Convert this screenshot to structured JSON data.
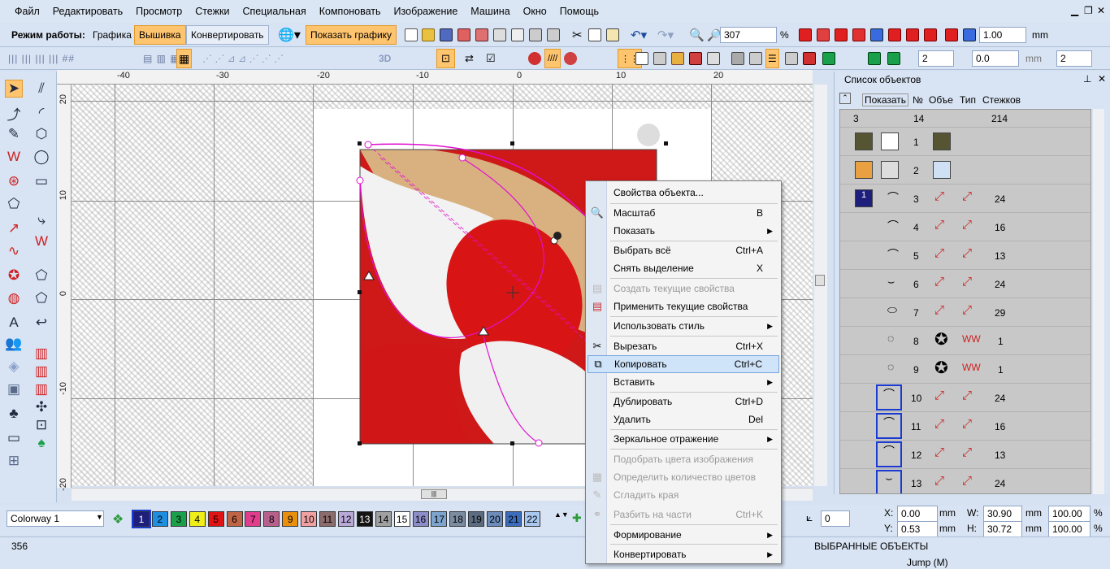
{
  "menubar": {
    "items": [
      "Файл",
      "Редактировать",
      "Просмотр",
      "Стежки",
      "Специальная",
      "Компоновать",
      "Изображение",
      "Машина",
      "Окно",
      "Помощь"
    ]
  },
  "toolbar": {
    "mode_label": "Режим работы:",
    "modes": [
      "Графика",
      "Вышивка",
      "Конвертировать"
    ],
    "show_graphics": "Показать графику",
    "zoom_value": "307",
    "zoom_unit": "%",
    "stitch_value": "1.00",
    "stitch_unit": "mm",
    "spin1": "2",
    "spin2": "0.0",
    "spin2_unit": "mm",
    "spin3": "2",
    "label_3d": "3D"
  },
  "ruler": {
    "top": [
      "-40",
      "-30",
      "-20",
      "-10",
      "0",
      "10",
      "20"
    ],
    "left": [
      "20",
      "10",
      "0",
      "-10",
      "-20"
    ]
  },
  "object_panel": {
    "title": "Список объектов",
    "headers": {
      "show": "Показать",
      "num": "№",
      "obj": "Объект",
      "type": "Тип",
      "stitches": "Стежков"
    },
    "summary": {
      "show": "3",
      "num": "14",
      "stitches": "214"
    },
    "rows": [
      {
        "num": "1",
        "stitches": ""
      },
      {
        "num": "2",
        "stitches": ""
      },
      {
        "num": "3",
        "stitches": "24"
      },
      {
        "num": "4",
        "stitches": "16"
      },
      {
        "num": "5",
        "stitches": "13"
      },
      {
        "num": "6",
        "stitches": "24"
      },
      {
        "num": "7",
        "stitches": "29"
      },
      {
        "num": "8",
        "stitches": "1"
      },
      {
        "num": "9",
        "stitches": "1"
      },
      {
        "num": "10",
        "stitches": "24"
      },
      {
        "num": "11",
        "stitches": "16"
      },
      {
        "num": "12",
        "stitches": "13"
      },
      {
        "num": "13",
        "stitches": "24"
      }
    ],
    "group_label": "1"
  },
  "context_menu": {
    "items": [
      {
        "label": "Свойства объекта...",
        "shortcut": "",
        "arrow": false,
        "disabled": false
      },
      {
        "label": "Масштаб",
        "shortcut": "B",
        "arrow": false,
        "disabled": false
      },
      {
        "label": "Показать",
        "shortcut": "",
        "arrow": true,
        "disabled": false
      },
      {
        "label": "Выбрать всё",
        "shortcut": "Ctrl+A",
        "arrow": false,
        "disabled": false
      },
      {
        "label": "Снять выделение",
        "shortcut": "X",
        "arrow": false,
        "disabled": false
      },
      {
        "label": "Создать текущие свойства",
        "shortcut": "",
        "arrow": false,
        "disabled": true
      },
      {
        "label": "Применить текущие свойства",
        "shortcut": "",
        "arrow": false,
        "disabled": false
      },
      {
        "label": "Использовать стиль",
        "shortcut": "",
        "arrow": true,
        "disabled": false
      },
      {
        "label": "Вырезать",
        "shortcut": "Ctrl+X",
        "arrow": false,
        "disabled": false
      },
      {
        "label": "Копировать",
        "shortcut": "Ctrl+C",
        "arrow": false,
        "disabled": false
      },
      {
        "label": "Вставить",
        "shortcut": "",
        "arrow": true,
        "disabled": false
      },
      {
        "label": "Дублировать",
        "shortcut": "Ctrl+D",
        "arrow": false,
        "disabled": false
      },
      {
        "label": "Удалить",
        "shortcut": "Del",
        "arrow": false,
        "disabled": false
      },
      {
        "label": "Зеркальное отражение",
        "shortcut": "",
        "arrow": true,
        "disabled": false
      },
      {
        "label": "Подобрать цвета изображения",
        "shortcut": "",
        "arrow": false,
        "disabled": true
      },
      {
        "label": "Определить количество цветов",
        "shortcut": "",
        "arrow": false,
        "disabled": true
      },
      {
        "label": "Сгладить края",
        "shortcut": "",
        "arrow": false,
        "disabled": true
      },
      {
        "label": "Разбить на части",
        "shortcut": "Ctrl+K",
        "arrow": false,
        "disabled": true
      },
      {
        "label": "Формирование",
        "shortcut": "",
        "arrow": true,
        "disabled": false
      },
      {
        "label": "Конвертировать",
        "shortcut": "",
        "arrow": true,
        "disabled": false
      }
    ]
  },
  "palette": {
    "colorway": "Colorway 1",
    "swatches": [
      {
        "n": "1",
        "c": "#1e1e7c",
        "t": "#fff"
      },
      {
        "n": "2",
        "c": "#1e8ee0",
        "t": "#000"
      },
      {
        "n": "3",
        "c": "#1aa04a",
        "t": "#000"
      },
      {
        "n": "4",
        "c": "#f0ee18",
        "t": "#000"
      },
      {
        "n": "5",
        "c": "#e01414",
        "t": "#000"
      },
      {
        "n": "6",
        "c": "#c06446",
        "t": "#000"
      },
      {
        "n": "7",
        "c": "#e23c8c",
        "t": "#000"
      },
      {
        "n": "8",
        "c": "#b8608c",
        "t": "#000"
      },
      {
        "n": "9",
        "c": "#e8900c",
        "t": "#000"
      },
      {
        "n": "10",
        "c": "#f0a0a0",
        "t": "#000"
      },
      {
        "n": "11",
        "c": "#8c6c6c",
        "t": "#000"
      },
      {
        "n": "12",
        "c": "#b8a8d8",
        "t": "#000"
      },
      {
        "n": "13",
        "c": "#141414",
        "t": "#fff"
      },
      {
        "n": "14",
        "c": "#a0a0a0",
        "t": "#000"
      },
      {
        "n": "15",
        "c": "#ffffff",
        "t": "#000"
      },
      {
        "n": "16",
        "c": "#8c8cc8",
        "t": "#000"
      },
      {
        "n": "17",
        "c": "#7ca4cc",
        "t": "#000"
      },
      {
        "n": "18",
        "c": "#7c8ca0",
        "t": "#000"
      },
      {
        "n": "19",
        "c": "#5c6c80",
        "t": "#000"
      },
      {
        "n": "20",
        "c": "#6c8cbc",
        "t": "#000"
      },
      {
        "n": "21",
        "c": "#3c6cbc",
        "t": "#000"
      },
      {
        "n": "22",
        "c": "#a8c8f0",
        "t": "#000"
      }
    ]
  },
  "coords": {
    "x_label": "X:",
    "x_value": "0.00",
    "y_label": "Y:",
    "y_value": "0.53",
    "w_label": "W:",
    "w_value": "30.90",
    "h_label": "H:",
    "h_value": "30.72",
    "unit": "mm",
    "w_pct": "100.00",
    "h_pct": "100.00",
    "pct": "%",
    "angle_value": "0"
  },
  "status": {
    "count": "356",
    "selected": "ВЫБРАННЫЕ ОБЪЕКТЫ",
    "jump": "Jump (M)"
  },
  "colors": {
    "accent": "#ffc46e",
    "highlight": "#cfe3f9",
    "outline": "#e010d0"
  }
}
